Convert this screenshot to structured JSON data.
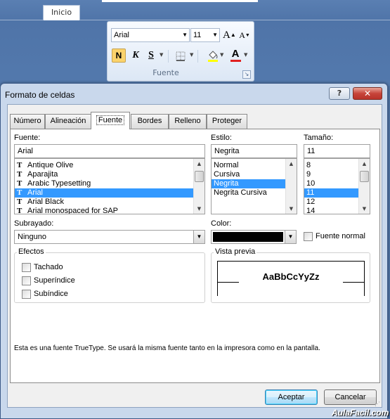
{
  "ribbon": {
    "tab_label": "Inicio",
    "font_name": "Arial",
    "font_size": "11",
    "grow_font": "A",
    "shrink_font": "A",
    "bold": "N",
    "italic": "K",
    "underline": "S",
    "font_color_glyph": "A",
    "group_caption": "Fuente",
    "font_color": "#e02020"
  },
  "dialog": {
    "title": "Formato de celdas",
    "help": "?",
    "close": "✕",
    "tabs": [
      "Número",
      "Alineación",
      "Fuente",
      "Bordes",
      "Relleno",
      "Proteger"
    ],
    "active_tab": "Fuente",
    "font": {
      "label": "Fuente:",
      "value": "Arial",
      "items": [
        "Antique Olive",
        "Aparajita",
        "Arabic Typesetting",
        "Arial",
        "Arial Black",
        "Arial monospaced for SAP"
      ],
      "selected": "Arial"
    },
    "style": {
      "label": "Estilo:",
      "value": "Negrita",
      "items": [
        "Normal",
        "Cursiva",
        "Negrita",
        "Negrita Cursiva"
      ],
      "selected": "Negrita"
    },
    "size": {
      "label": "Tamaño:",
      "value": "11",
      "items": [
        "8",
        "9",
        "10",
        "11",
        "12",
        "14"
      ],
      "selected": "11"
    },
    "underline": {
      "label": "Subrayado:",
      "value": "Ninguno"
    },
    "color": {
      "label": "Color:",
      "value": "#000000"
    },
    "normal_font": {
      "label": "Fuente normal",
      "checked": false
    },
    "effects": {
      "label": "Efectos",
      "items": [
        {
          "label": "Tachado",
          "checked": false
        },
        {
          "label": "Superíndice",
          "checked": false
        },
        {
          "label": "Subíndice",
          "checked": false
        }
      ]
    },
    "preview": {
      "label": "Vista previa",
      "sample": "AaBbCcYyZz"
    },
    "info": "Esta es una fuente TrueType. Se usará la misma fuente tanto en la impresora como en la pantalla.",
    "ok": "Aceptar",
    "cancel": "Cancelar"
  },
  "watermark": "AulaFacil.com"
}
